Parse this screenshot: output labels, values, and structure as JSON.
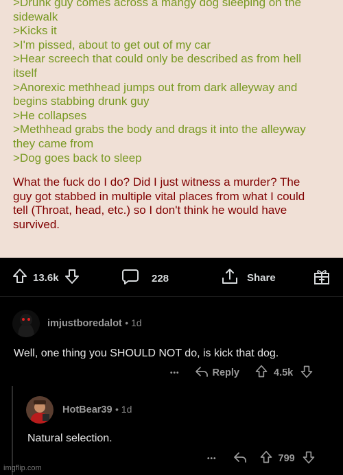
{
  "post": {
    "greentext": [
      ">Drunk guy comes across a mangy dog sleeping on the",
      "sidewalk",
      ">Kicks it",
      ">I'm pissed, about to get out of my car",
      ">Hear screech that could only be described as from hell",
      "itself",
      ">Anorexic methhead jumps out from dark alleyway and",
      "begins stabbing drunk guy",
      ">He collapses",
      ">Methhead grabs the body and drags it into the alleyway",
      "they came from",
      ">Dog goes back to sleep"
    ],
    "body": [
      "What the fuck do I do? Did I just witness a murder? The",
      "guy got stabbed in multiple vital places from what I could",
      "tell (Throat, head, etc.) so I don't think he would have",
      "survived."
    ]
  },
  "actions": {
    "upvotes": "13.6k",
    "comments": "228",
    "share": "Share"
  },
  "comments": [
    {
      "author": "imjustboredalot",
      "time": "1d",
      "text": "Well, one thing you SHOULD NOT do, is kick that dog.",
      "more": "•••",
      "reply": "Reply",
      "votes": "4.5k"
    },
    {
      "author": "HotBear39",
      "time": "1d",
      "text": "Natural selection.",
      "more": "•••",
      "votes": "799"
    }
  ],
  "watermark": "imgflip.com",
  "colors": {
    "card_bg": "#f0e0d6",
    "greentext": "#789922",
    "body_text": "#800000",
    "bg": "#000000"
  }
}
